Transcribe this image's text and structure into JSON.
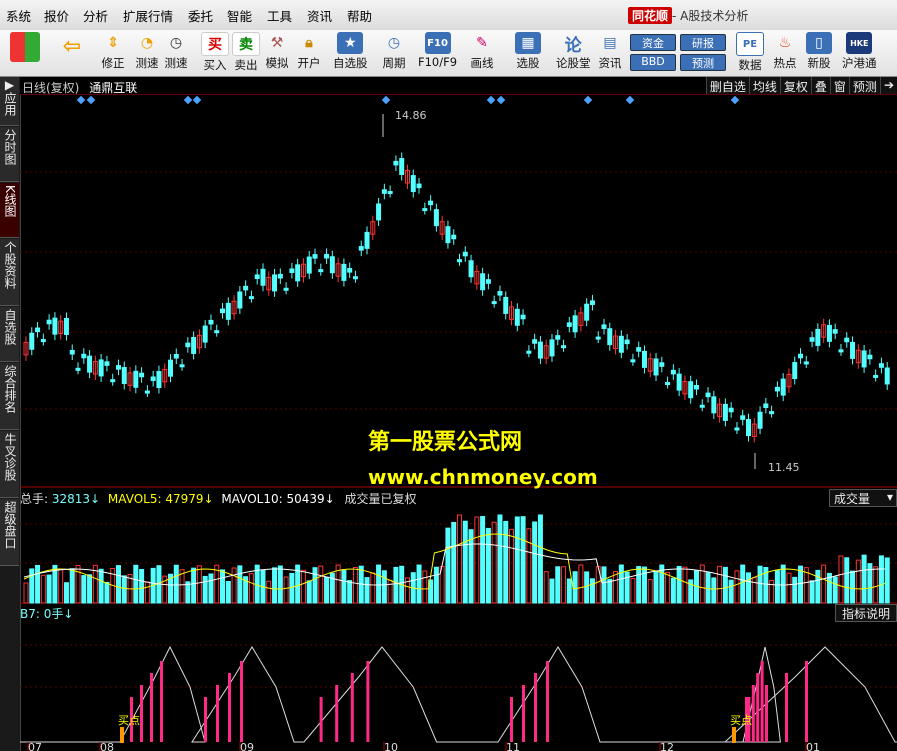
{
  "menu": {
    "items": [
      "系统",
      "报价",
      "分析",
      "扩展行情",
      "委托",
      "智能",
      "工具",
      "资讯",
      "帮助"
    ],
    "brand": "同花顺",
    "app_title": "- A股技术分析"
  },
  "toolbar": {
    "buttons": [
      {
        "label": "修正",
        "icon": "up-down-arrow-icon"
      },
      {
        "label": "测速",
        "icon": "clock-icon"
      },
      {
        "label": "买入",
        "icon": "buy-icon"
      },
      {
        "label": "卖出",
        "icon": "sell-icon"
      },
      {
        "label": "模拟",
        "icon": "hammer-icon"
      },
      {
        "label": "开户",
        "icon": "lock-icon"
      },
      {
        "label": "自选股",
        "icon": "star-icon"
      },
      {
        "label": "周期",
        "icon": "clock-icon"
      },
      {
        "label": "F10/F9",
        "icon": "f10-icon"
      },
      {
        "label": "画线",
        "icon": "pen-icon"
      },
      {
        "label": "选股",
        "icon": "chart-icon"
      },
      {
        "label": "论股堂",
        "icon": "forum-icon"
      },
      {
        "label": "资讯",
        "icon": "doc-icon"
      },
      {
        "label": "数据",
        "icon": "pe-icon"
      },
      {
        "label": "热点",
        "icon": "fire-icon"
      },
      {
        "label": "新股",
        "icon": "ipo-icon"
      },
      {
        "label": "沪港通",
        "icon": "hk-icon"
      }
    ],
    "small": {
      "fund": "资金",
      "bbd": "BBD",
      "research": "研报",
      "forecast": "预测"
    }
  },
  "sidebar": {
    "tabs": [
      {
        "label": "应用",
        "glyph": "▶"
      },
      {
        "label": "分时图"
      },
      {
        "label": "K线图",
        "active": true
      },
      {
        "label": "个股资料"
      },
      {
        "label": "自选股"
      },
      {
        "label": "综合排名"
      },
      {
        "label": "牛叉诊股"
      },
      {
        "label": "超级盘口"
      }
    ]
  },
  "chart": {
    "period": "日线(复权)",
    "stock_name": "通鼎互联",
    "head_buttons": [
      "删自选",
      "均线",
      "复权",
      "叠",
      "窗",
      "预测",
      "➔"
    ],
    "high_label": "14.86",
    "low_label": "11.45",
    "watermark_cn": "第一股票公式网",
    "watermark_url": "www.chnmoney.com",
    "vol": {
      "total_label": "总手: ",
      "total": "32813↓",
      "ma5_label": "MAVOL5: ",
      "ma5": "47979↓",
      "ma10_label": "MAVOL10: ",
      "ma10": "50439↓",
      "note": "成交量已复权",
      "dropdown": "成交量"
    },
    "indicator": {
      "label": "B7: 0手↓",
      "button": "指标说明",
      "buy_label": "买点"
    },
    "months": [
      "07",
      "08",
      "09",
      "10",
      "11",
      "12",
      "01"
    ],
    "colors": {
      "up": "#ff3232",
      "down": "#54ffff",
      "diamond": "#4aa3ff",
      "grid": "#5a0000",
      "magenta": "#ff2a88",
      "yellow": "#ffff00"
    }
  }
}
